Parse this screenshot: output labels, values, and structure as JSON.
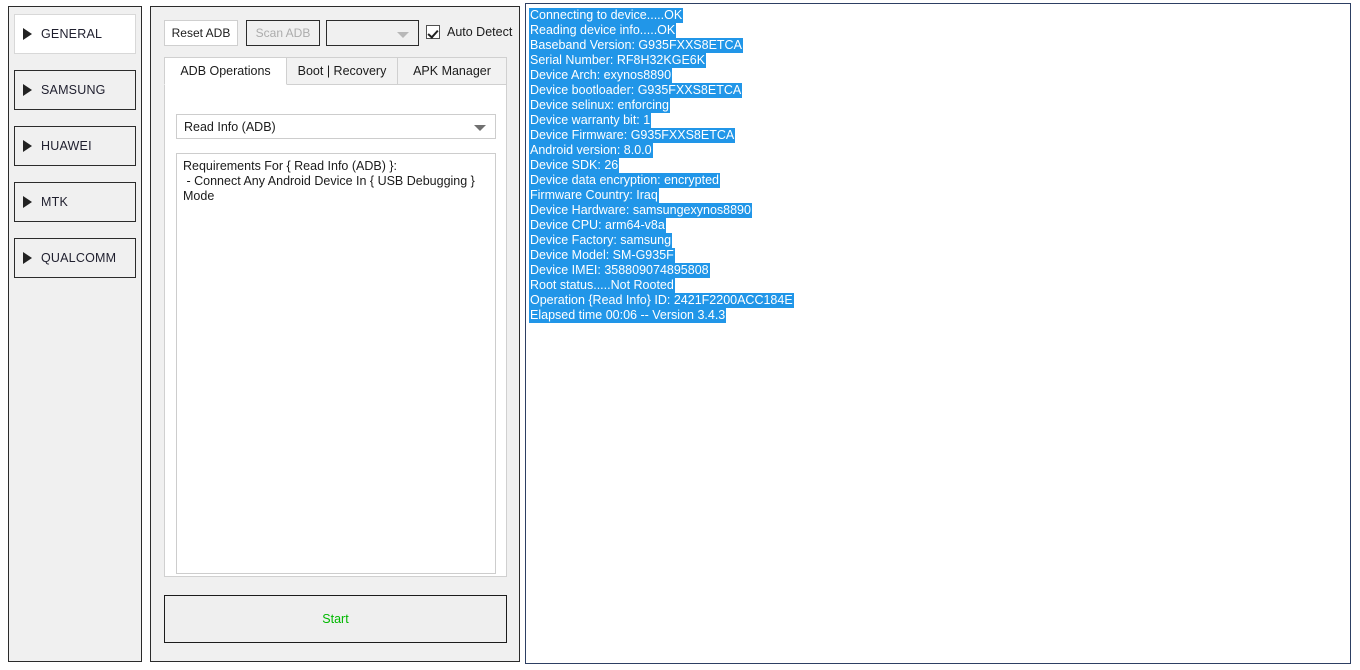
{
  "sidebar": {
    "items": [
      {
        "label": "GENERAL",
        "icon": "triangle-right-icon",
        "selected": true
      },
      {
        "label": "SAMSUNG",
        "icon": "triangle-right-icon",
        "selected": false
      },
      {
        "label": "HUAWEI",
        "icon": "triangle-right-icon",
        "selected": false
      },
      {
        "label": "MTK",
        "icon": "triangle-right-icon",
        "selected": false
      },
      {
        "label": "QUALCOMM",
        "icon": "triangle-right-icon",
        "selected": false
      }
    ]
  },
  "toolbar": {
    "reset_adb_label": "Reset ADB",
    "scan_adb_label": "Scan ADB",
    "scan_adb_enabled": false,
    "device_combo_value": "",
    "device_combo_icon": "chevron-down-icon",
    "auto_detect_label": "Auto Detect",
    "auto_detect_checked": true,
    "check_icon": "checkmark-icon"
  },
  "tabs": [
    {
      "label": "ADB Operations",
      "active": true
    },
    {
      "label": "Boot | Recovery",
      "active": false
    },
    {
      "label": "APK Manager",
      "active": false
    }
  ],
  "operation": {
    "selected": "Read Info (ADB)",
    "combo_icon": "chevron-down-icon",
    "requirements_text": "Requirements For { Read Info (ADB) }:\n - Connect Any Android Device In { USB Debugging }\nMode"
  },
  "start": {
    "label": "Start",
    "color": "#00b800"
  },
  "log": {
    "selection_color": "#2196e8",
    "selection_text_color": "#ffffff",
    "lines": [
      "Connecting to device.....OK",
      "Reading device info.....OK",
      "Baseband Version: G935FXXS8ETCA",
      "Serial Number: RF8H32KGE6K",
      "Device Arch: exynos8890",
      "Device bootloader: G935FXXS8ETCA",
      "Device selinux: enforcing",
      "Device warranty bit: 1",
      "Device Firmware: G935FXXS8ETCA",
      "Android version: 8.0.0",
      "Device SDK: 26",
      "Device data encryption: encrypted",
      "Firmware Country: Iraq",
      "Device Hardware: samsungexynos8890",
      "Device CPU: arm64-v8a",
      "Device Factory: samsung",
      "Device Model: SM-G935F",
      "Device IMEI: 358809074895808",
      "Root status.....Not Rooted",
      "Operation {Read Info} ID: 2421F2200ACC184E",
      "Elapsed time 00:06 -- Version 3.4.3"
    ]
  }
}
